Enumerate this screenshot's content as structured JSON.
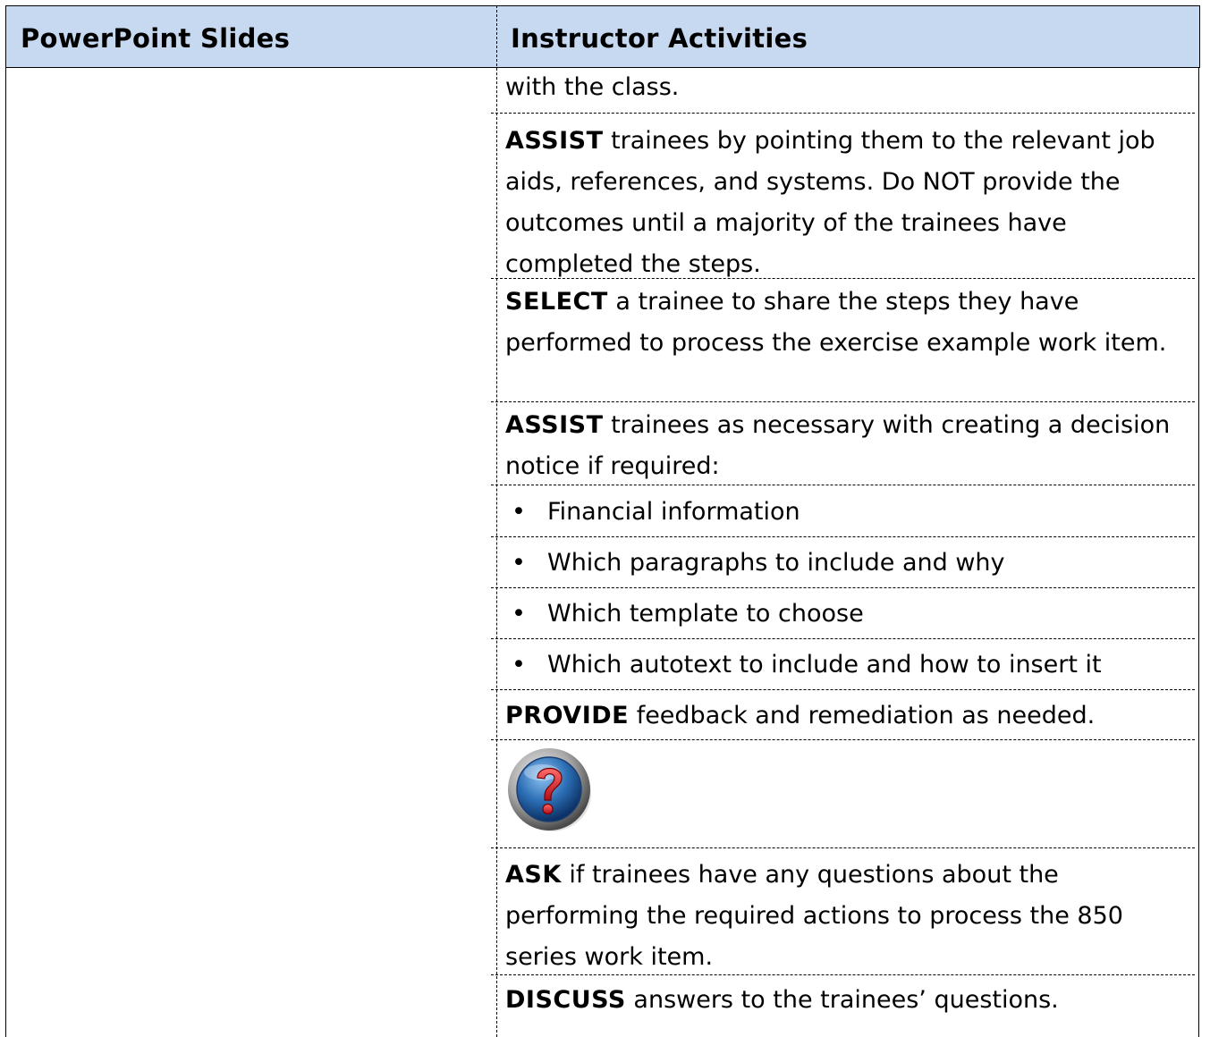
{
  "header": {
    "col_left": "PowerPoint Slides",
    "col_right": "Instructor Activities"
  },
  "rows": [
    {
      "text": "with the class."
    },
    {
      "bold": "ASSIST",
      "text": " trainees by pointing them to the relevant job aids, references, and systems. Do NOT provide the outcomes until a majority of the trainees have completed the steps."
    },
    {
      "bold": "SELECT",
      "text": " a trainee to share the steps they have performed to process the exercise example work item."
    },
    {
      "bold": "ASSIST",
      "text": " trainees as necessary with creating a decision notice if required:"
    },
    {
      "bullet": "Financial information"
    },
    {
      "bullet": "Which paragraphs to include and why"
    },
    {
      "bullet": "Which template to choose"
    },
    {
      "bullet": "Which autotext to include and how to insert it"
    },
    {
      "bold": "PROVIDE",
      "text": " feedback and remediation as needed."
    },
    {
      "icon": "question-mark-icon"
    },
    {
      "bold": "ASK",
      "text": " if trainees have any questions about the performing the required actions to process the 850 series work item."
    },
    {
      "bold": "DISCUSS",
      "text": " answers to the trainees’ questions."
    }
  ],
  "colors": {
    "header_bg": "#c6d9f1",
    "icon_blue": "#2c6fb5",
    "icon_red": "#d4202a"
  }
}
